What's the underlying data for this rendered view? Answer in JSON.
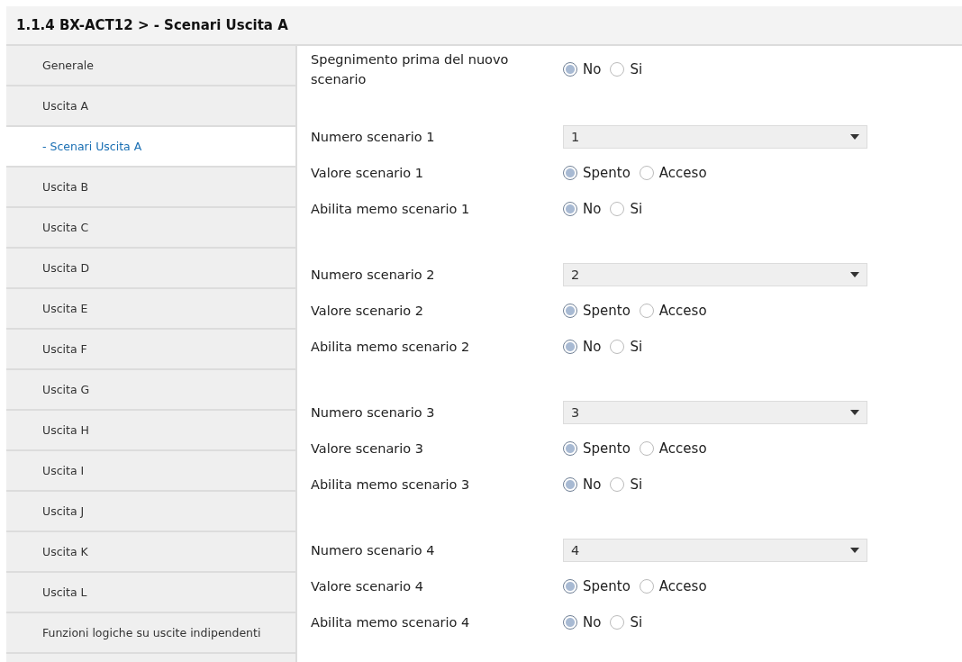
{
  "header": {
    "title": "1.1.4 BX-ACT12 > - Scenari Uscita A"
  },
  "sidebar": {
    "items": [
      {
        "label": "Generale",
        "selected": false
      },
      {
        "label": "Uscita A",
        "selected": false
      },
      {
        "label": "- Scenari Uscita A",
        "selected": true
      },
      {
        "label": "Uscita B",
        "selected": false
      },
      {
        "label": "Uscita C",
        "selected": false
      },
      {
        "label": "Uscita D",
        "selected": false
      },
      {
        "label": "Uscita E",
        "selected": false
      },
      {
        "label": "Uscita F",
        "selected": false
      },
      {
        "label": "Uscita G",
        "selected": false
      },
      {
        "label": "Uscita H",
        "selected": false
      },
      {
        "label": "Uscita I",
        "selected": false
      },
      {
        "label": "Uscita J",
        "selected": false
      },
      {
        "label": "Uscita K",
        "selected": false
      },
      {
        "label": "Uscita L",
        "selected": false
      },
      {
        "label": "Funzioni logiche su uscite indipendenti",
        "selected": false
      }
    ]
  },
  "groups": [
    {
      "rows": [
        {
          "kind": "radio",
          "label": "Spegnimento prima del nuovo scenario",
          "options": [
            {
              "label": "No",
              "selected": true
            },
            {
              "label": "Si",
              "selected": false
            }
          ]
        }
      ]
    },
    {
      "rows": [
        {
          "kind": "select",
          "label": "Numero scenario 1",
          "value": "1"
        },
        {
          "kind": "radio",
          "label": "Valore scenario 1",
          "options": [
            {
              "label": "Spento",
              "selected": true
            },
            {
              "label": "Acceso",
              "selected": false
            }
          ]
        },
        {
          "kind": "radio",
          "label": "Abilita memo scenario 1",
          "options": [
            {
              "label": "No",
              "selected": true
            },
            {
              "label": "Si",
              "selected": false
            }
          ]
        }
      ]
    },
    {
      "rows": [
        {
          "kind": "select",
          "label": "Numero scenario 2",
          "value": "2"
        },
        {
          "kind": "radio",
          "label": "Valore scenario 2",
          "options": [
            {
              "label": "Spento",
              "selected": true
            },
            {
              "label": "Acceso",
              "selected": false
            }
          ]
        },
        {
          "kind": "radio",
          "label": "Abilita memo scenario 2",
          "options": [
            {
              "label": "No",
              "selected": true
            },
            {
              "label": "Si",
              "selected": false
            }
          ]
        }
      ]
    },
    {
      "rows": [
        {
          "kind": "select",
          "label": "Numero scenario 3",
          "value": "3"
        },
        {
          "kind": "radio",
          "label": "Valore scenario 3",
          "options": [
            {
              "label": "Spento",
              "selected": true
            },
            {
              "label": "Acceso",
              "selected": false
            }
          ]
        },
        {
          "kind": "radio",
          "label": "Abilita memo scenario 3",
          "options": [
            {
              "label": "No",
              "selected": true
            },
            {
              "label": "Si",
              "selected": false
            }
          ]
        }
      ]
    },
    {
      "rows": [
        {
          "kind": "select",
          "label": "Numero scenario 4",
          "value": "4"
        },
        {
          "kind": "radio",
          "label": "Valore scenario 4",
          "options": [
            {
              "label": "Spento",
              "selected": true
            },
            {
              "label": "Acceso",
              "selected": false
            }
          ]
        },
        {
          "kind": "radio",
          "label": "Abilita memo scenario 4",
          "options": [
            {
              "label": "No",
              "selected": true
            },
            {
              "label": "Si",
              "selected": false
            }
          ]
        }
      ]
    }
  ]
}
